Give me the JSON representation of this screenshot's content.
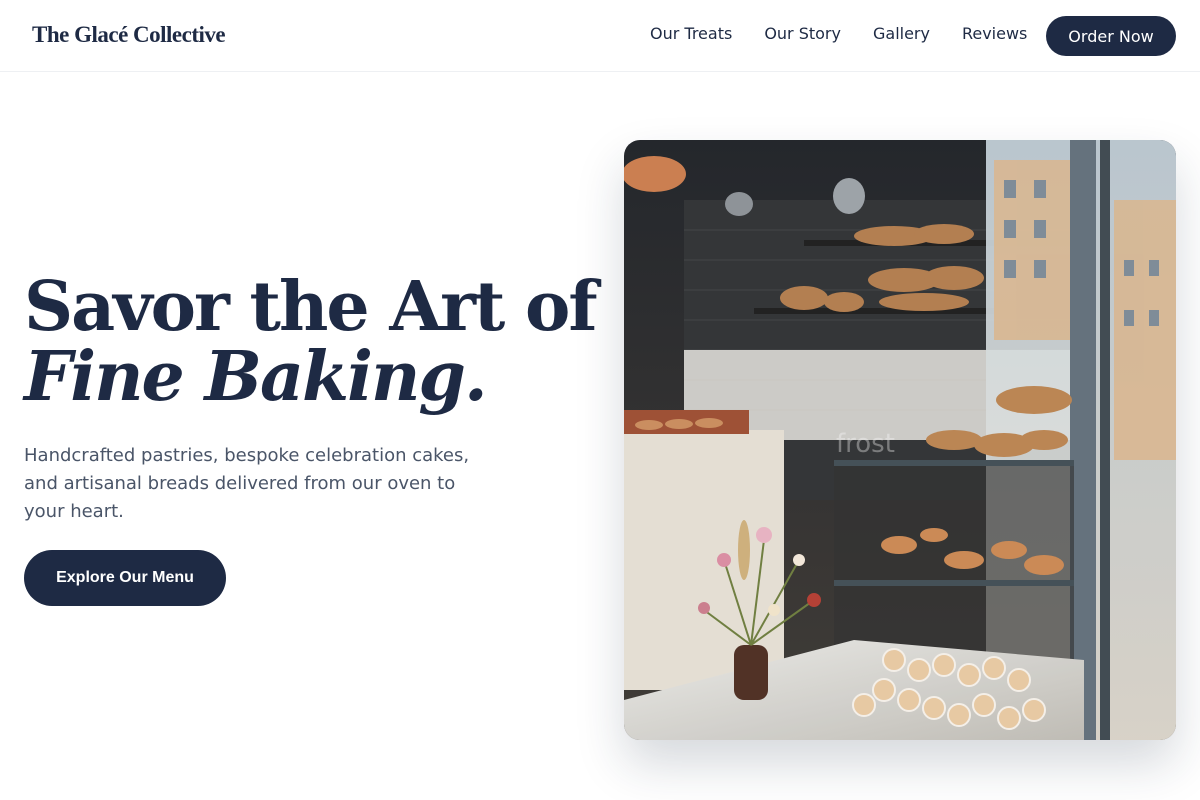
{
  "header": {
    "logo": "The Glacé Collective",
    "nav": [
      {
        "label": "Our Treats"
      },
      {
        "label": "Our Story"
      },
      {
        "label": "Gallery"
      },
      {
        "label": "Reviews"
      }
    ],
    "cta_label": "Order Now"
  },
  "hero": {
    "title_line1": "Savor the Art of",
    "title_line2": "Fine Baking.",
    "description": "Handcrafted pastries, bespoke celebration cakes, and artisanal breads delivered from our oven to your heart.",
    "button_label": "Explore Our Menu",
    "image_text": "frost"
  },
  "colors": {
    "primary": "#1e2a44",
    "text_muted": "#4a5568",
    "background": "#ffffff"
  }
}
